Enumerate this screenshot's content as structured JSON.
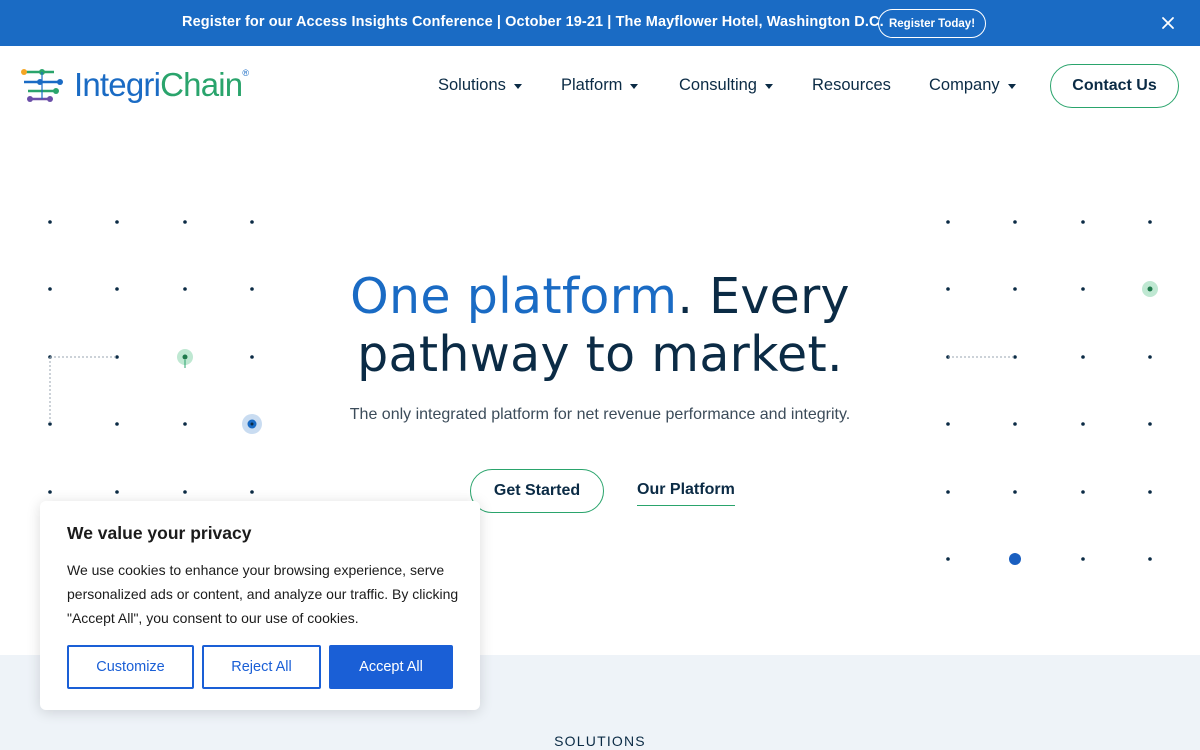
{
  "announcement": {
    "text": "Register for our Access Insights Conference | October 19-21 | The Mayflower Hotel, Washington D.C.",
    "button_label": "Register Today!",
    "close_icon": "close-icon"
  },
  "brand": {
    "name_part1": "Integri",
    "name_part2": "Chain",
    "trademark": "®",
    "logo_icon": "integrichain-logo-icon",
    "colors": {
      "blue": "#1a6bc4",
      "green": "#2aa46c",
      "navy": "#0b2b45",
      "purple": "#6b4fa8",
      "orange": "#f5a623"
    }
  },
  "nav": {
    "items": [
      {
        "label": "Solutions",
        "has_dropdown": true
      },
      {
        "label": "Platform",
        "has_dropdown": true
      },
      {
        "label": "Consulting",
        "has_dropdown": true
      },
      {
        "label": "Resources",
        "has_dropdown": false
      },
      {
        "label": "Company",
        "has_dropdown": true
      }
    ],
    "contact_label": "Contact Us"
  },
  "hero": {
    "title_accent": "One platform",
    "title_rest_line1": ". Every",
    "title_line2": "pathway to market.",
    "subtitle": "The only integrated platform for net revenue performance and integrity.",
    "primary_cta": "Get Started",
    "secondary_cta": "Our Platform"
  },
  "cookie": {
    "title": "We value your privacy",
    "body": "We use cookies to enhance your browsing experience, serve personalized ads or content, and analyze our traffic. By clicking \"Accept All\", you consent to our use of cookies.",
    "customize_label": "Customize",
    "reject_label": "Reject All",
    "accept_label": "Accept All",
    "accent_color": "#1a5fd6"
  },
  "lower_section": {
    "label": "SOLUTIONS"
  }
}
